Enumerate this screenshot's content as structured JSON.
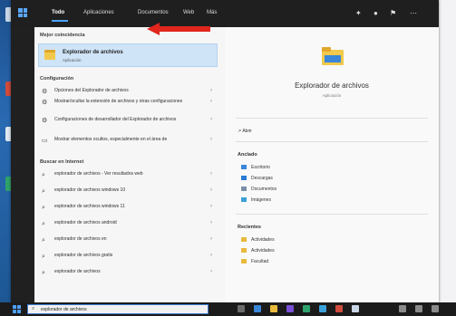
{
  "header": {
    "tabs": [
      {
        "label": "Todo"
      },
      {
        "label": "Aplicaciones"
      },
      {
        "label": "Documentos"
      },
      {
        "label": "Web"
      },
      {
        "label": "Más"
      }
    ]
  },
  "results": {
    "best_match_header": "Mejor coincidencia",
    "best_match": {
      "title": "Explorador de archivos",
      "subtitle": "Aplicación"
    },
    "settings_header": "Configuración",
    "settings": [
      {
        "label": "Opciones del Explorador de archivos",
        "icon": "options-icon"
      },
      {
        "label": "Mostrar/ocultar la extensión de archivos y otras configuraciones",
        "icon": "settings-icon"
      },
      {
        "label": "Configuraciones de desarrollador del Explorador de archivos",
        "icon": "dev-settings-icon"
      },
      {
        "label": "Mostrar elementos ocultos, especialmente en el área de",
        "icon": "display-icon"
      }
    ],
    "web_header": "Buscar en Internet",
    "web": [
      {
        "label": "explorador de archivos - Ver resultados web"
      },
      {
        "label": "explorador de archivos windows 10"
      },
      {
        "label": "explorador de archivos windows 11"
      },
      {
        "label": "explorador de archivos android"
      },
      {
        "label": "explorador de archivos en"
      },
      {
        "label": "explorador de archivos gratis"
      },
      {
        "label": "explorador de archivos"
      }
    ]
  },
  "preview": {
    "title": "Explorador de archivos",
    "subtitle": "Aplicación",
    "open_label": "Abrir",
    "quick_access_header": "Anclado",
    "quick_access": [
      {
        "label": "Escritorio",
        "color": "#3a86d8"
      },
      {
        "label": "Descargas",
        "color": "#2d7bd3"
      },
      {
        "label": "Documentos",
        "color": "#7b8ea8"
      },
      {
        "label": "Imágenes",
        "color": "#3aa0d8"
      }
    ],
    "recent_header": "Recientes",
    "recent": [
      {
        "label": "Actividades",
        "color": "#e8b93c"
      },
      {
        "label": "Actividades",
        "color": "#e8b93c"
      },
      {
        "label": "Facultad",
        "color": "#e8b93c"
      }
    ]
  },
  "taskbar": {
    "search_text": "explorador de archivos"
  },
  "colors": {
    "accent": "#4aa3ff",
    "arrow": "#e0261d",
    "selection": "#cfe4f7"
  }
}
